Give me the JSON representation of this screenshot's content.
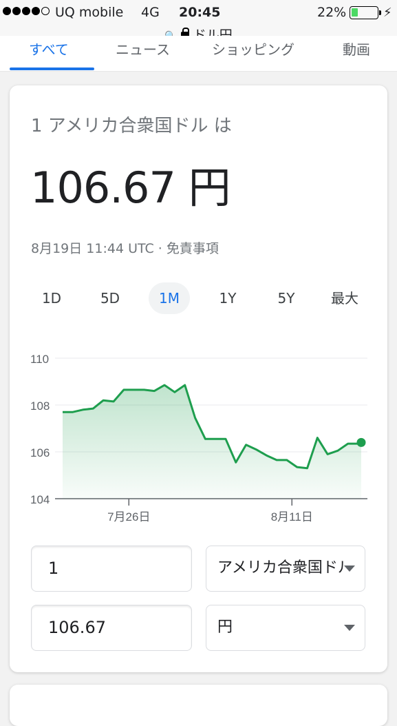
{
  "status_bar": {
    "carrier": "UQ mobile",
    "network": "4G",
    "time": "20:45",
    "battery_percent": "22%",
    "signal_bars_filled": 4,
    "signal_bars_total": 5,
    "battery_level": 0.22
  },
  "url_bar": {
    "domain": "ドル円"
  },
  "tabs": [
    {
      "label": "すべて"
    },
    {
      "label": "ニュース"
    },
    {
      "label": "ショッピング"
    },
    {
      "label": "動画"
    }
  ],
  "converter": {
    "intro": "1 アメリカ合衆国ドル は",
    "rate": "106.67 円",
    "timestamp": "8月19日 11:44 UTC · 免責事項",
    "ranges": [
      "1D",
      "5D",
      "1M",
      "1Y",
      "5Y",
      "最大"
    ],
    "active_range": "1M",
    "amount_from": "1",
    "currency_from": "アメリカ合衆国ドル",
    "amount_to": "106.67",
    "currency_to": "円"
  },
  "colors": {
    "accent": "#1a73e8",
    "line": "#1e9e4e",
    "fill": "#dff3e6",
    "muted": "#70757a"
  },
  "chart_data": {
    "type": "area",
    "y_ticks": [
      "110",
      "108",
      "106",
      "104"
    ],
    "ylim": [
      104,
      110
    ],
    "x_ticks": [
      {
        "label": "7月26日",
        "x": 6.5
      },
      {
        "label": "8月11日",
        "x": 22.5
      }
    ],
    "x": [
      0,
      1,
      2,
      3,
      4,
      5,
      6,
      7,
      8,
      9,
      10,
      11,
      12,
      13,
      14,
      15,
      16,
      17,
      18,
      19,
      20,
      21,
      22,
      23,
      24,
      25,
      26,
      27,
      28,
      29
    ],
    "values": [
      107.7,
      107.7,
      107.8,
      107.85,
      108.2,
      108.15,
      108.65,
      108.65,
      108.65,
      108.6,
      108.85,
      108.55,
      108.85,
      107.45,
      106.55,
      106.55,
      106.55,
      105.55,
      106.3,
      106.1,
      105.85,
      105.65,
      105.65,
      105.35,
      105.3,
      106.6,
      105.9,
      106.05,
      106.35,
      106.35
    ],
    "last_value": 106.4,
    "grid": true
  }
}
